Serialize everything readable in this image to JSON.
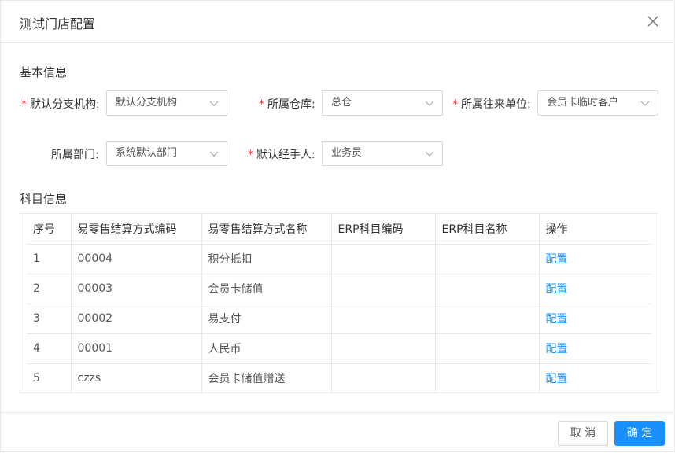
{
  "dialog": {
    "title": "测试门店配置",
    "close_icon": "close-icon"
  },
  "basic": {
    "section_title": "基本信息",
    "fields": {
      "branch": {
        "label": "默认分支机构:",
        "value": "默认分支机构",
        "required": true
      },
      "warehouse": {
        "label": "所属仓库:",
        "value": "总仓",
        "required": true
      },
      "partner": {
        "label": "所属往来单位:",
        "value": "会员卡临时客户",
        "required": true
      },
      "department": {
        "label": "所属部门:",
        "value": "系统默认部门",
        "required": false
      },
      "handler": {
        "label": "默认经手人:",
        "value": "业务员",
        "required": true
      }
    },
    "required_mark": "*"
  },
  "subjects": {
    "section_title": "科目信息",
    "columns": [
      "序号",
      "易零售结算方式编码",
      "易零售结算方式名称",
      "ERP科目编码",
      "ERP科目名称",
      "操作"
    ],
    "rows": [
      {
        "no": "1",
        "code": "00004",
        "name": "积分抵扣",
        "erp_code": "",
        "erp_name": "",
        "action": "配置"
      },
      {
        "no": "2",
        "code": "00003",
        "name": "会员卡储值",
        "erp_code": "",
        "erp_name": "",
        "action": "配置"
      },
      {
        "no": "3",
        "code": "00002",
        "name": "易支付",
        "erp_code": "",
        "erp_name": "",
        "action": "配置"
      },
      {
        "no": "4",
        "code": "00001",
        "name": "人民币",
        "erp_code": "",
        "erp_name": "",
        "action": "配置"
      },
      {
        "no": "5",
        "code": "czzs",
        "name": "会员卡储值赠送",
        "erp_code": "",
        "erp_name": "",
        "action": "配置"
      }
    ]
  },
  "footer": {
    "cancel_label": "取 消",
    "ok_label": "确 定"
  },
  "colors": {
    "primary": "#1890ff",
    "required": "#e0393e",
    "border": "#e8e8e8"
  }
}
